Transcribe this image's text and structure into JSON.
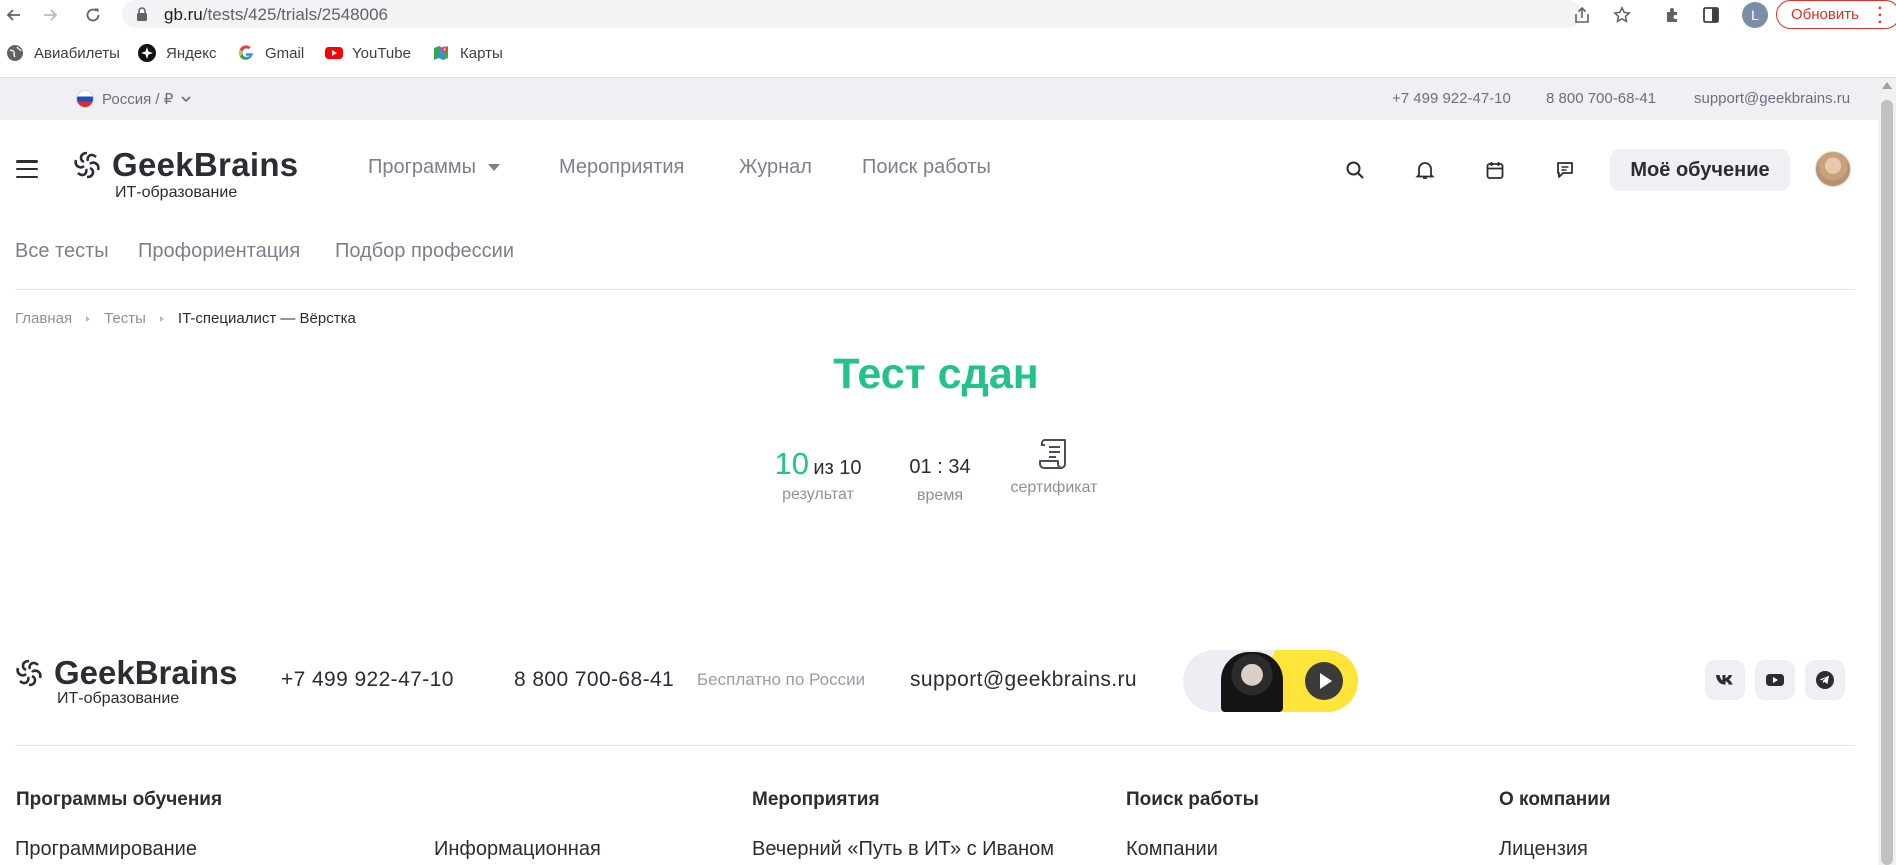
{
  "browser": {
    "url_host": "gb.ru",
    "url_path": "/tests/425/trials/2548006",
    "profile_initial": "L",
    "update_label": "Обновить",
    "bookmarks": [
      {
        "label": "Авиабилеты",
        "icon": "globe-icon"
      },
      {
        "label": "Яндекс",
        "icon": "yandex-icon"
      },
      {
        "label": "Gmail",
        "icon": "google-icon"
      },
      {
        "label": "YouTube",
        "icon": "youtube-icon"
      },
      {
        "label": "Карты",
        "icon": "maps-icon"
      }
    ],
    "colors": {
      "update": "#d93025",
      "omnibox": "#f1f3f4"
    }
  },
  "topstrip": {
    "region": "Россия / ₽",
    "phone1": "+7 499 922-47-10",
    "phone2": "8 800 700-68-41",
    "email": "support@geekbrains.ru"
  },
  "header": {
    "logo_word": "GeekBrains",
    "logo_sub": "ИТ-образование",
    "nav": [
      "Программы",
      "Мероприятия",
      "Журнал",
      "Поиск работы"
    ],
    "my_learning": "Моё обучение",
    "icons": [
      "search-icon",
      "bell-icon",
      "calendar-icon",
      "chat-icon"
    ]
  },
  "subnav": [
    "Все тесты",
    "Профориентация",
    "Подбор профессии"
  ],
  "breadcrumb": [
    "Главная",
    "Тесты",
    "IT-специалист — Вёрстка"
  ],
  "result": {
    "title": "Тест сдан",
    "score": "10",
    "score_of": "из 10",
    "score_label": "результат",
    "time": "01 : 34",
    "time_label": "время",
    "certificate_label": "сертификат",
    "accent": "#23c287"
  },
  "footer": {
    "logo_word": "GeekBrains",
    "logo_sub": "ИТ-образование",
    "phone1": "+7 499 922-47-10",
    "phone2": "8 800 700-68-41",
    "phone2_note": "Бесплатно по России",
    "email": "support@geekbrains.ru",
    "social": [
      "vk-icon",
      "youtube-icon",
      "telegram-icon"
    ],
    "columns": [
      {
        "heading": "Программы обучения",
        "links": [
          "Программирование",
          "Информационная"
        ]
      },
      {
        "heading": "Мероприятия",
        "links": [
          "Вечерний «Путь в ИТ» с Иваном"
        ]
      },
      {
        "heading": "Поиск работы",
        "links": [
          "Компании"
        ]
      },
      {
        "heading": "О компании",
        "links": [
          "Лицензия"
        ]
      }
    ]
  }
}
